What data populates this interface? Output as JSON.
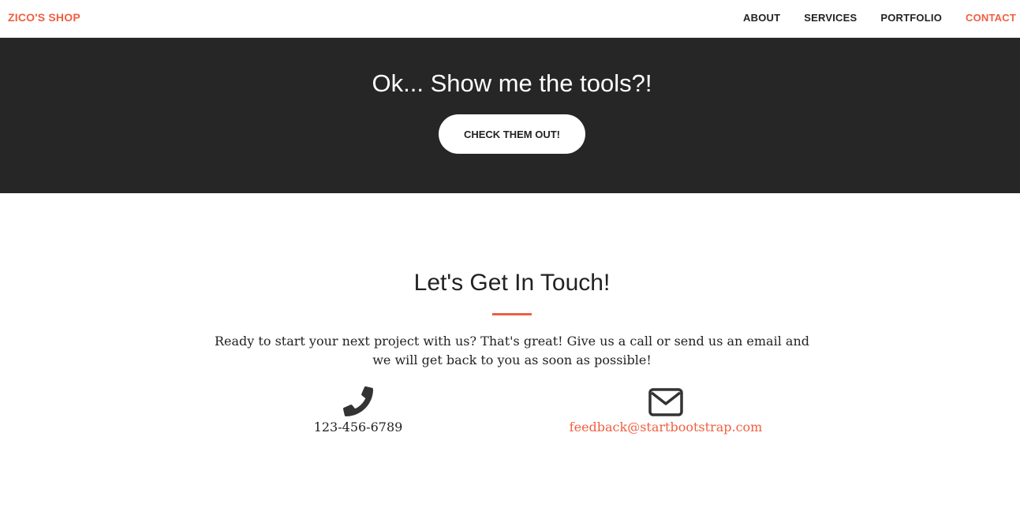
{
  "navbar": {
    "brand": "ZICO'S SHOP",
    "items": [
      {
        "label": "ABOUT",
        "active": false
      },
      {
        "label": "SERVICES",
        "active": false
      },
      {
        "label": "PORTFOLIO",
        "active": false
      },
      {
        "label": "CONTACT",
        "active": true
      }
    ]
  },
  "tools_band": {
    "heading": "Ok... Show me the tools?!",
    "button_label": "CHECK THEM OUT!"
  },
  "contact": {
    "title": "Let's Get In Touch!",
    "text": "Ready to start your next project with us? That's great! Give us a call or send us an email and we will get back to you as soon as possible!",
    "phone": "123-456-6789",
    "email": "feedback@startbootstrap.com",
    "phone_icon": "phone-icon",
    "email_icon": "envelope-icon"
  },
  "colors": {
    "accent": "#f05f40",
    "dark_band": "#262626",
    "text": "#222222"
  }
}
